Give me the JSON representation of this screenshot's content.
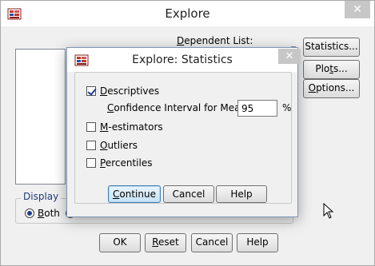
{
  "explore": {
    "title": "Explore",
    "close_glyph": "✕",
    "dependent_list_label": "Dependent List:",
    "buttons": {
      "statistics": "Statistics...",
      "plots": "Plots...",
      "options": "Options...",
      "ok": "OK",
      "reset": "Reset",
      "cancel": "Cancel",
      "help": "Help"
    },
    "display": {
      "legend": "Display",
      "selected": "Both",
      "options": [
        "Both"
      ]
    }
  },
  "stats_dialog": {
    "title": "Explore: Statistics",
    "close_glyph": "✕",
    "descriptives": {
      "label": "Descriptives",
      "checked": true
    },
    "confidence_interval": {
      "label": "Confidence Interval for Mean:",
      "value": "95",
      "unit": "%"
    },
    "m_estimators": {
      "label": "M-estimators",
      "checked": false
    },
    "outliers": {
      "label": "Outliers",
      "checked": false
    },
    "percentiles": {
      "label": "Percentiles",
      "checked": false
    },
    "buttons": {
      "continue": "Continue",
      "cancel": "Cancel",
      "help": "Help"
    }
  }
}
